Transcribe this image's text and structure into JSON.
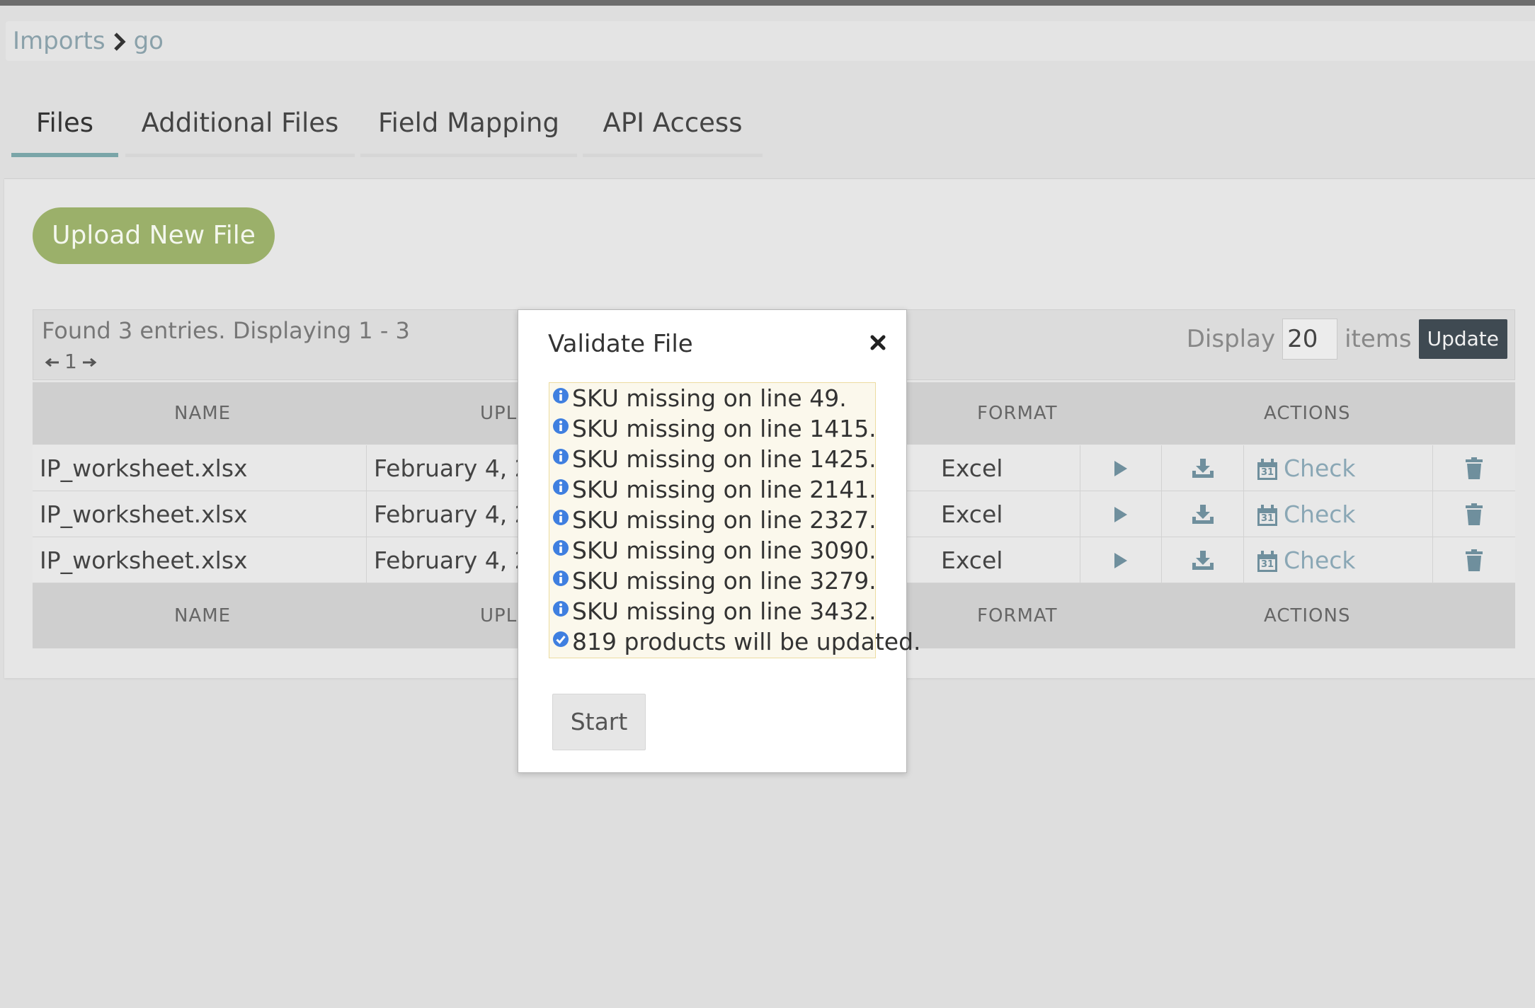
{
  "breadcrumb": {
    "root": "Imports",
    "current": "go"
  },
  "tabs": [
    {
      "label": "Files",
      "active": true
    },
    {
      "label": "Additional Files",
      "active": false
    },
    {
      "label": "Field Mapping",
      "active": false
    },
    {
      "label": "API Access",
      "active": false
    }
  ],
  "upload_button": "Upload New File",
  "table_info": {
    "found_text": "Found 3 entries. Displaying 1 - 3",
    "page_number": "1",
    "display_label": "Display",
    "display_value": "20",
    "items_label": "items",
    "update_label": "Update"
  },
  "columns": {
    "name": "NAME",
    "uploaded": "UPL",
    "format": "FORMAT",
    "actions": "ACTIONS"
  },
  "rows": [
    {
      "name": "IP_worksheet.xlsx",
      "date": "February 4, 20",
      "format": "Excel",
      "check": "Check"
    },
    {
      "name": "IP_worksheet.xlsx",
      "date": "February 4, 20",
      "format": "Excel",
      "check": "Check"
    },
    {
      "name": "IP_worksheet.xlsx",
      "date": "February 4, 20",
      "format": "Excel",
      "check": "Check"
    }
  ],
  "calendar_day": "31",
  "modal": {
    "title": "Validate File",
    "messages": [
      {
        "text": "SKU missing on line 49.",
        "icon": "info-icon"
      },
      {
        "text": "SKU missing on line 1415.",
        "icon": "info-icon"
      },
      {
        "text": "SKU missing on line 1425.",
        "icon": "info-icon"
      },
      {
        "text": "SKU missing on line 2141.",
        "icon": "info-icon"
      },
      {
        "text": "SKU missing on line 2327.",
        "icon": "info-icon"
      },
      {
        "text": "SKU missing on line 3090.",
        "icon": "info-icon"
      },
      {
        "text": "SKU missing on line 3279.",
        "icon": "info-icon"
      },
      {
        "text": "SKU missing on line 3432.",
        "icon": "info-icon"
      },
      {
        "text": "819 products will be updated.",
        "icon": "check-circle-icon"
      }
    ],
    "start_label": "Start"
  },
  "colors": {
    "accent_teal": "#7aa5a8",
    "upload_green": "#9bb06a",
    "update_dark": "#3f4a52",
    "info_blue": "#3f7fe0",
    "icon_slate": "#6f8f9d"
  }
}
